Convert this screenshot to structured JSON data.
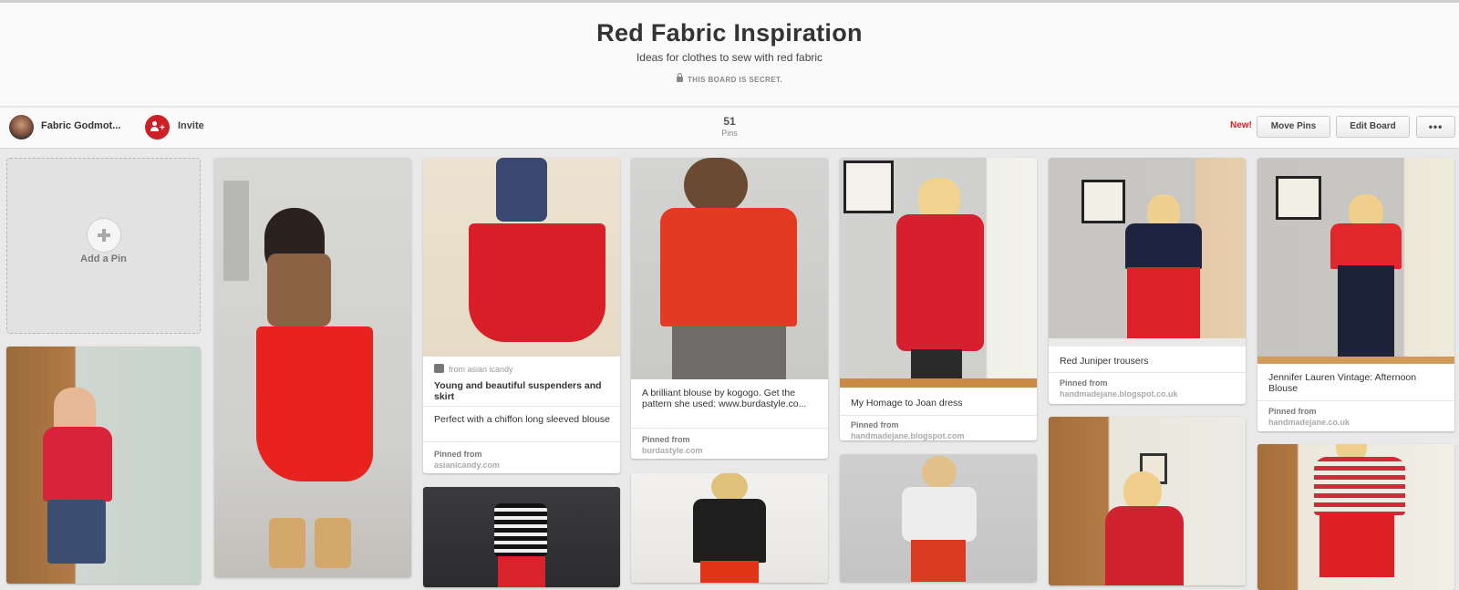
{
  "board": {
    "title": "Red Fabric Inspiration",
    "description": "Ideas for clothes to sew with red fabric",
    "secret_label": "THIS BOARD IS SECRET."
  },
  "toolbar": {
    "owner_name": "Fabric Godmot...",
    "invite_label": "Invite",
    "pin_count": "51",
    "pin_count_label": "Pins",
    "new_badge": "New!",
    "move_pins_label": "Move Pins",
    "edit_board_label": "Edit Board",
    "more_label": "•••"
  },
  "add_pin": {
    "label": "Add a Pin"
  },
  "pins": [
    {
      "id": "p1",
      "image": "woman in red skirt and leopard blouse"
    },
    {
      "id": "p2",
      "image": "woman in red top and jeans"
    },
    {
      "id": "p3",
      "image": "red suspender skirt",
      "from": "from asian icandy",
      "title": "Young and beautiful suspenders and skirt",
      "comment": "Perfect with a chiffon long sleeved blouse",
      "pinned_label": "Pinned from",
      "source": "asianicandy.com"
    },
    {
      "id": "p4",
      "image": "striped top and red skirt"
    },
    {
      "id": "p5",
      "image": "red button blouse",
      "title": "A brilliant blouse by kogogo. Get the pattern she used: www.burdastyle.co...",
      "pinned_label": "Pinned from",
      "source": "burdastyle.com"
    },
    {
      "id": "p6",
      "image": "black jacket and red trousers"
    },
    {
      "id": "p7",
      "image": "red dress",
      "title": "My Homage to Joan dress",
      "pinned_label": "Pinned from",
      "source": "handmadejane.blogspot.com"
    },
    {
      "id": "p8",
      "image": "white cardigan and red trousers"
    },
    {
      "id": "p9",
      "image": "navy top and red trousers",
      "title": "Red Juniper trousers",
      "pinned_label": "Pinned from",
      "source": "handmadejane.blogspot.co.uk"
    },
    {
      "id": "p10",
      "image": "red sleeveless top"
    },
    {
      "id": "p11",
      "image": "red blouse and navy trousers",
      "title": "Jennifer Lauren Vintage: Afternoon Blouse",
      "pinned_label": "Pinned from",
      "source": "handmadejane.co.uk"
    },
    {
      "id": "p12",
      "image": "striped top and red skirt"
    }
  ],
  "colors": {
    "accent": "#cb2027",
    "background": "#e9e9e9"
  }
}
